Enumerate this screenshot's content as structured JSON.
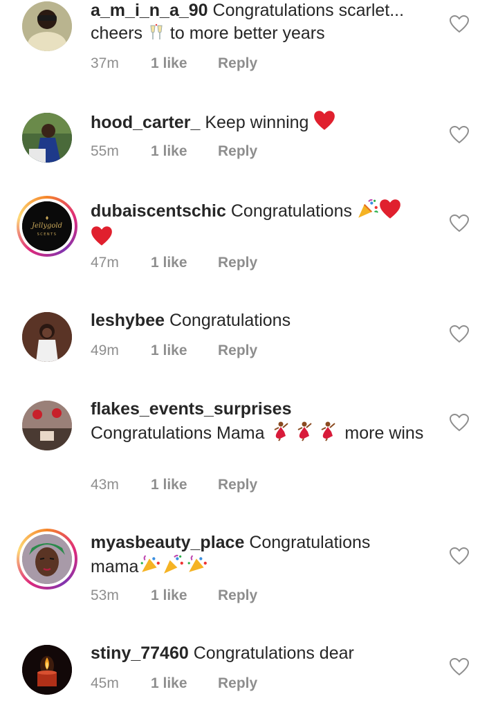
{
  "comments": [
    {
      "username": "a_m_i_n_a_90",
      "text": "Congratulations scarlet... cheers ",
      "text_after": " to more better years",
      "time": "37m",
      "likes": "1 like",
      "reply": "Reply",
      "avatar_color": "#d8d0a8"
    },
    {
      "username": "hood_carter_",
      "text": "Keep winning",
      "time": "55m",
      "likes": "1 like",
      "reply": "Reply",
      "avatar_color": "#2b4a2e"
    },
    {
      "username": "dubaiscentschic",
      "text": "Congratulations",
      "time": "47m",
      "likes": "1 like",
      "reply": "Reply",
      "avatar_logo": "Jellygold",
      "avatar_logo_sub": "SCENTS"
    },
    {
      "username": "leshybee",
      "text": "Congratulations",
      "time": "49m",
      "likes": "1 like",
      "reply": "Reply",
      "avatar_color": "#4a2b20"
    },
    {
      "username": "flakes_events_surprises",
      "text": "Congratulations Mama ",
      "text_after": " more wins",
      "time": "43m",
      "likes": "1 like",
      "reply": "Reply",
      "avatar_color": "#8a6a60"
    },
    {
      "username": "myasbeauty_place",
      "text": "Congratulations mama",
      "time": "53m",
      "likes": "1 like",
      "reply": "Reply",
      "avatar_color": "#6a8a60"
    },
    {
      "username": "stiny_77460",
      "text": "Congratulations dear",
      "time": "45m",
      "likes": "1 like",
      "reply": "Reply",
      "avatar_color": "#1a1010"
    }
  ],
  "colors": {
    "text": "#262626",
    "meta": "#8e8e8e",
    "heart_red": "#e0202e",
    "story_ring": "#dd2a7b"
  },
  "icons": {
    "like": "heart-outline-icon",
    "emoji_heart": "red-heart-emoji",
    "emoji_party": "party-popper-emoji",
    "emoji_cheers": "clinking-glasses-emoji",
    "emoji_dancer": "dancer-emoji"
  }
}
